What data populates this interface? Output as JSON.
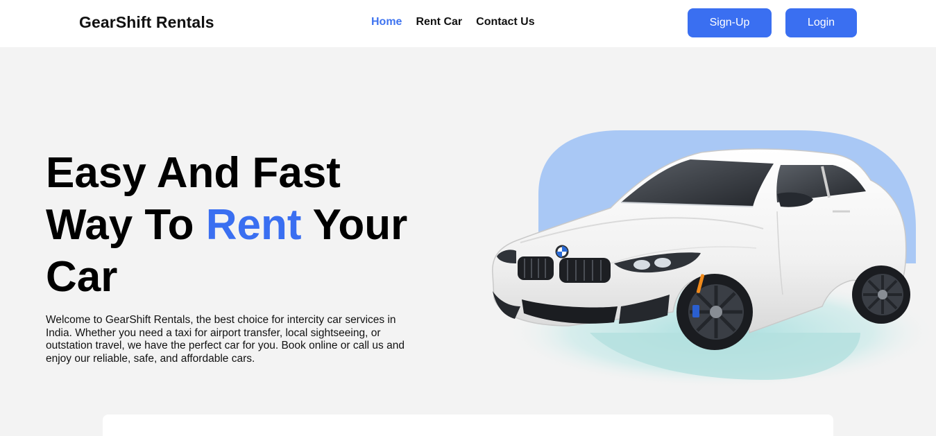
{
  "nav": {
    "brand": "GearShift Rentals",
    "links": [
      {
        "label": "Home",
        "active": true
      },
      {
        "label": "Rent Car",
        "active": false
      },
      {
        "label": "Contact Us",
        "active": false
      }
    ],
    "signup_label": "Sign-Up",
    "login_label": "Login"
  },
  "hero": {
    "title_line1": "Easy And Fast",
    "title_line2_pre": "Way To ",
    "title_line2_accent": "Rent",
    "title_line2_post": " Your",
    "title_line3": "Car",
    "description": "Welcome to GearShift Rentals, the best choice for intercity car services in India. Whether you need a taxi for airport transfer, local sightseeing, or outstation travel, we have the perfect car for you. Book online or call us and enjoy our reliable, safe, and affordable cars."
  },
  "colors": {
    "accent": "#3a6ff1",
    "blob": "#a9c8f5",
    "shadow_teal": "#b7e4e4"
  }
}
